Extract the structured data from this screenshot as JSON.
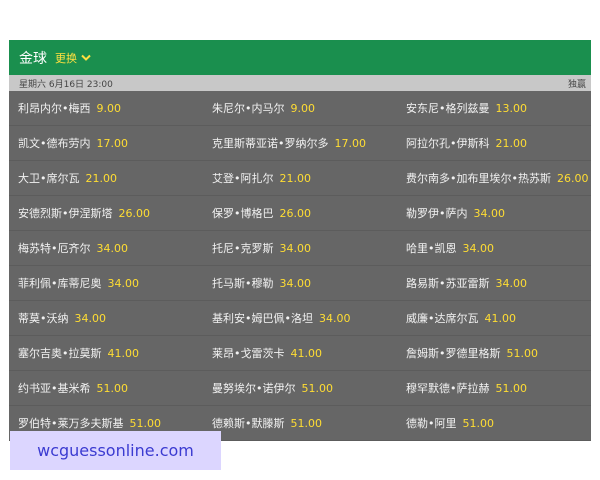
{
  "header": {
    "title": "金球",
    "switch_label": "更换"
  },
  "subbar": {
    "date": "星期六 6月16日 23:00",
    "right_label": "独赢"
  },
  "colors": {
    "header_bg": "#1a8f4e",
    "panel_bg": "#666666",
    "odds": "#ffdd33",
    "watermark_bg": "#dcd6ff",
    "watermark_text": "#3b3bd1"
  },
  "players": [
    {
      "name": "利昂内尔•梅西",
      "odds": "9.00"
    },
    {
      "name": "朱尼尔•内马尔",
      "odds": "9.00"
    },
    {
      "name": "安东尼•格列兹曼",
      "odds": "13.00"
    },
    {
      "name": "凯文•德布劳内",
      "odds": "17.00"
    },
    {
      "name": "克里斯蒂亚诺•罗纳尔多",
      "odds": "17.00"
    },
    {
      "name": "阿拉尔孔•伊斯科",
      "odds": "21.00"
    },
    {
      "name": "大卫•席尔瓦",
      "odds": "21.00"
    },
    {
      "name": "艾登•阿扎尔",
      "odds": "21.00"
    },
    {
      "name": "费尔南多•加布里埃尔•热苏斯",
      "odds": "26.00"
    },
    {
      "name": "安德烈斯•伊涅斯塔",
      "odds": "26.00"
    },
    {
      "name": "保罗•博格巴",
      "odds": "26.00"
    },
    {
      "name": "勒罗伊•萨内",
      "odds": "34.00"
    },
    {
      "name": "梅苏特•厄齐尔",
      "odds": "34.00"
    },
    {
      "name": "托尼•克罗斯",
      "odds": "34.00"
    },
    {
      "name": "哈里•凯恩",
      "odds": "34.00"
    },
    {
      "name": "菲利佩•库蒂尼奥",
      "odds": "34.00"
    },
    {
      "name": "托马斯•穆勒",
      "odds": "34.00"
    },
    {
      "name": "路易斯•苏亚雷斯",
      "odds": "34.00"
    },
    {
      "name": "蒂莫•沃纳",
      "odds": "34.00"
    },
    {
      "name": "基利安•姆巴佩•洛坦",
      "odds": "34.00"
    },
    {
      "name": "威廉•达席尔瓦",
      "odds": "41.00"
    },
    {
      "name": "塞尔吉奥•拉莫斯",
      "odds": "41.00"
    },
    {
      "name": "莱昂•戈雷茨卡",
      "odds": "41.00"
    },
    {
      "name": "詹姆斯•罗德里格斯",
      "odds": "51.00"
    },
    {
      "name": "约书亚•基米希",
      "odds": "51.00"
    },
    {
      "name": "曼努埃尔•诺伊尔",
      "odds": "51.00"
    },
    {
      "name": "穆罕默德•萨拉赫",
      "odds": "51.00"
    },
    {
      "name": "罗伯特•莱万多夫斯基",
      "odds": "51.00"
    },
    {
      "name": "德赖斯•默滕斯",
      "odds": "51.00"
    },
    {
      "name": "德勒•阿里",
      "odds": "51.00"
    }
  ],
  "watermark": "wcguessonline.com"
}
